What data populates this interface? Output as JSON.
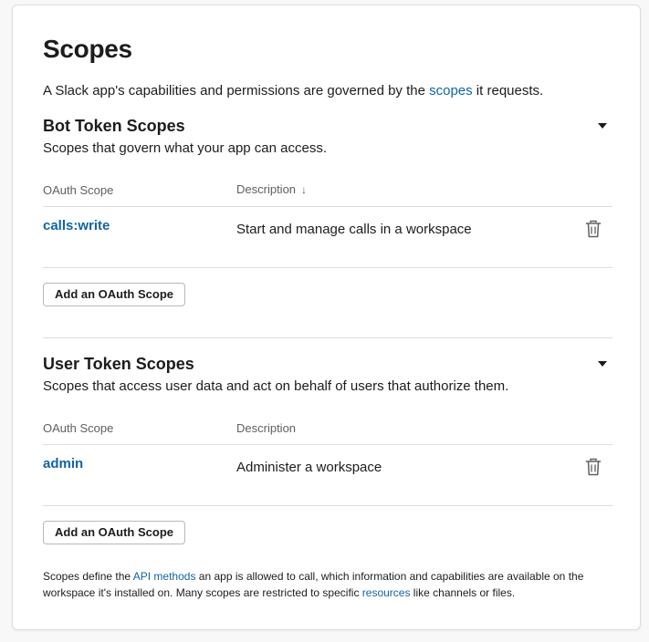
{
  "title": "Scopes",
  "intro": {
    "before": "A Slack app's capabilities and permissions are governed by the ",
    "link": "scopes",
    "after": " it requests."
  },
  "bot": {
    "title": "Bot Token Scopes",
    "subtitle": "Scopes that govern what your app can access.",
    "col_scope": "OAuth Scope",
    "col_desc": "Description",
    "sort_icon": "↓",
    "rows": [
      {
        "scope": "calls:write",
        "description": "Start and manage calls in a workspace"
      }
    ],
    "add_button": "Add an OAuth Scope"
  },
  "user": {
    "title": "User Token Scopes",
    "subtitle": "Scopes that access user data and act on behalf of users that authorize them.",
    "col_scope": "OAuth Scope",
    "col_desc": "Description",
    "rows": [
      {
        "scope": "admin",
        "description": "Administer a workspace"
      }
    ],
    "add_button": "Add an OAuth Scope"
  },
  "footer": {
    "t1": "Scopes define the ",
    "l1": "API methods",
    "t2": " an app is allowed to call, which information and capabilities are available on the workspace it's installed on. Many scopes are restricted to specific ",
    "l2": "resources",
    "t3": " like channels or files."
  },
  "colors": {
    "link": "#1264a3",
    "text": "#1d1c1d",
    "muted": "#616061",
    "divider": "#dddddd"
  },
  "icons": {
    "collapse": "caret-down-icon",
    "remove": "trash-icon",
    "sort": "arrow-down-icon"
  }
}
